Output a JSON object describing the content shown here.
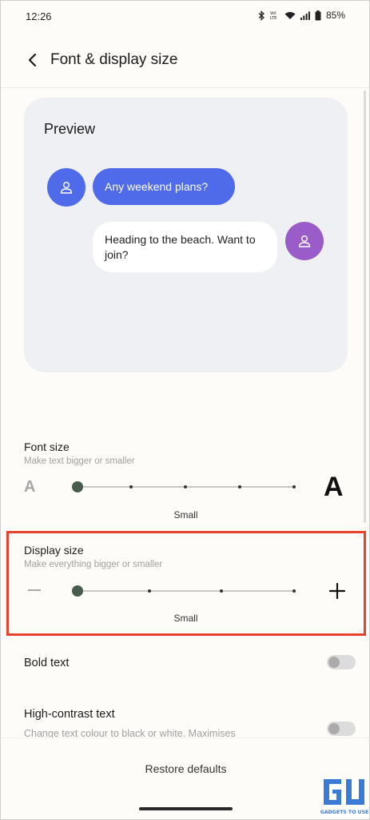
{
  "status_bar": {
    "time": "12:26",
    "battery": "85%",
    "icons": [
      "bluetooth-icon",
      "volte-icon",
      "wifi-icon",
      "signal-icon",
      "battery-icon"
    ]
  },
  "header": {
    "back_icon": "back-arrow-icon",
    "title": "Font & display size"
  },
  "preview": {
    "title": "Preview",
    "incoming_message": "Any weekend plans?",
    "outgoing_message": "Heading to the beach. Want to join?",
    "avatar_icon": "person-icon",
    "colors": {
      "incoming": "#4f6bea",
      "outgoing_avatar": "#9a5cc9"
    }
  },
  "font_size": {
    "title": "Font size",
    "subtitle": "Make text bigger or smaller",
    "small_glyph": "A",
    "large_glyph": "A",
    "value": "Small",
    "steps": 5,
    "selected_step": 1
  },
  "display_size": {
    "title": "Display size",
    "subtitle": "Make everything bigger or smaller",
    "value": "Small",
    "steps": 4,
    "selected_step": 1,
    "highlight_color": "#e8412c"
  },
  "bold_text": {
    "title": "Bold text",
    "enabled": false
  },
  "high_contrast": {
    "title": "High-contrast text",
    "subtitle": "Change text colour to black or white. Maximises",
    "enabled": false
  },
  "footer": {
    "restore_label": "Restore defaults"
  },
  "watermark": {
    "logo": "gadgets-to-use-logo",
    "text": "GADGETS TO USE"
  }
}
